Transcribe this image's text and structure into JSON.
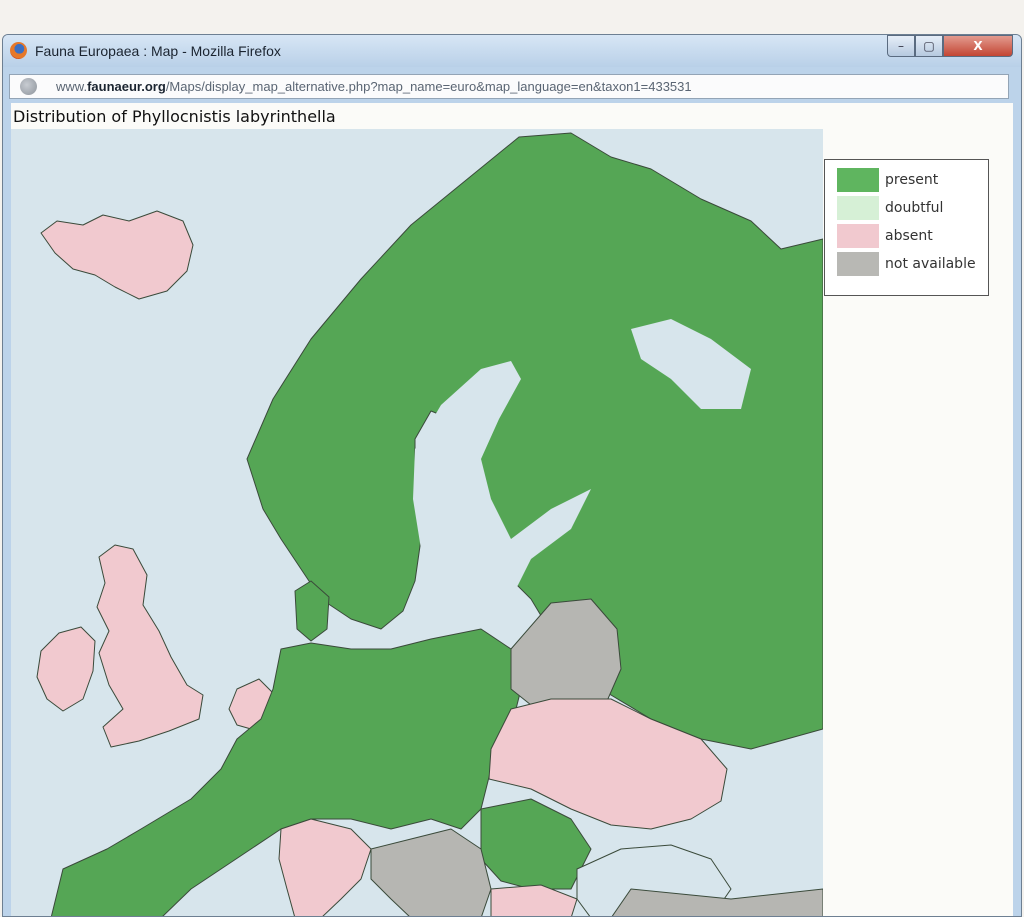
{
  "window": {
    "title": "Fauna Europaea : Map - Mozilla Firefox",
    "controls": {
      "minimize": "–",
      "maximize": "▢",
      "close": "X"
    }
  },
  "address_bar": {
    "url_prefix": "www.",
    "url_domain": "faunaeur.org",
    "url_path": "/Maps/display_map_alternative.php?map_name=euro&map_language=en&taxon1=433531"
  },
  "map": {
    "title": "Distribution of Phyllocnistis labyrinthella"
  },
  "legend": {
    "items": [
      {
        "label": "present",
        "color": "#5fb55f"
      },
      {
        "label": "doubtful",
        "color": "#d6f0d6"
      },
      {
        "label": "absent",
        "color": "#f1c9cf"
      },
      {
        "label": "not available",
        "color": "#b8b8b4"
      }
    ]
  },
  "colors": {
    "present": "#55a655",
    "absent": "#f1c9cf",
    "not_available": "#b6b6b2",
    "sea": "#d7e5ec",
    "border": "#3a4a3a"
  }
}
